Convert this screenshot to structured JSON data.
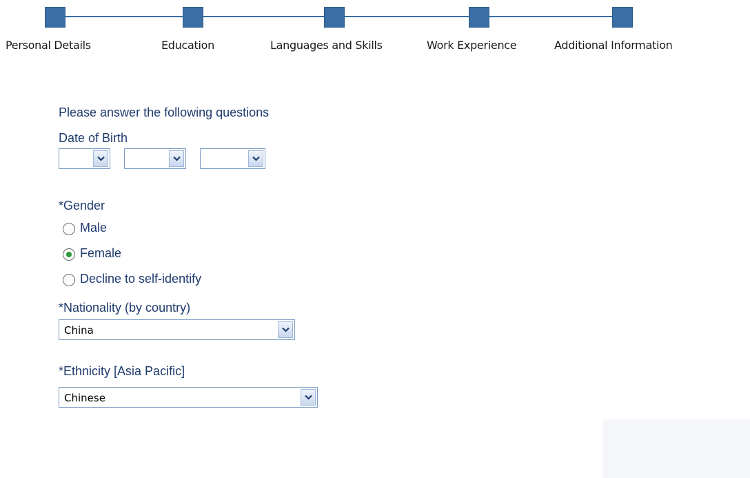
{
  "stepper": {
    "steps": [
      {
        "label": "Personal Details"
      },
      {
        "label": "Education"
      },
      {
        "label": "Languages and Skills"
      },
      {
        "label": "Work Experience"
      },
      {
        "label": "Additional Information"
      }
    ],
    "color": "#3a6ea5"
  },
  "form": {
    "intro": "Please answer the following questions",
    "dob": {
      "label": "Date of Birth",
      "selects": [
        {
          "value": ""
        },
        {
          "value": ""
        },
        {
          "value": ""
        }
      ]
    },
    "gender": {
      "label": "*Gender",
      "options": [
        {
          "label": "Male",
          "selected": false
        },
        {
          "label": "Female",
          "selected": true
        },
        {
          "label": "Decline to self-identify",
          "selected": false
        }
      ]
    },
    "nationality": {
      "label": "*Nationality (by country)",
      "value": "China"
    },
    "ethnicity": {
      "label": "*Ethnicity [Asia Pacific]",
      "value": "Chinese"
    }
  },
  "icons": {
    "dropdown": "chevron-down-icon",
    "step": "step-square-icon"
  },
  "colors": {
    "label_text": "#1f3b6e",
    "radio_selected": "#2e9a3a"
  }
}
